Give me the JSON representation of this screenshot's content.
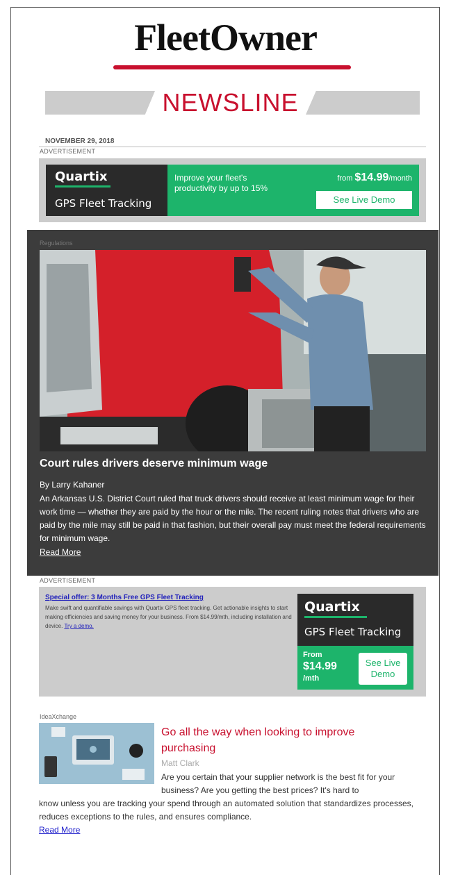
{
  "header": {
    "logo": "FleetOwner",
    "newsline": "NEWSLINE",
    "date": "NOVEMBER 29, 2018"
  },
  "ad1": {
    "label": "ADVERTISEMENT",
    "brand": "Quartix",
    "product": "GPS Fleet Tracking",
    "tagline": "Improve your fleet's productivity by up to 15%",
    "price_prefix": "from",
    "price": "$14.99",
    "price_suffix": "/month",
    "cta": "See Live Demo"
  },
  "feature": {
    "category": "Regulations",
    "title": "Court rules drivers deserve minimum wage",
    "byline": "By Larry Kahaner",
    "body": "An Arkansas U.S. District Court ruled that truck drivers should receive at least minimum wage for their work time — whether they are paid by the hour or the mile. The recent ruling notes that drivers who are paid by the mile may still be paid in that fashion, but their overall pay must meet the federal requirements for minimum wage.",
    "read_more": "Read More"
  },
  "ad2": {
    "label": "ADVERTISEMENT",
    "title": "Special offer: 3 Months Free GPS Fleet Tracking",
    "body": "Make swift and quantifiable savings with Quartix GPS fleet tracking. Get actionable insights to start making efficiencies and saving money for your business. From $14.99/mth, including installation and device.",
    "link": "Try a demo.",
    "brand": "Quartix",
    "product": "GPS Fleet Tracking",
    "from": "From",
    "price": "$14.99",
    "per": "/mth",
    "cta": "See Live Demo"
  },
  "story2": {
    "category": "IdeaXchange",
    "title": "Go all the way when looking to improve purchasing",
    "author": "Matt Clark",
    "body_part1": "Are you certain that your supplier network is the best fit for your business? Are you getting the best prices? It's hard to",
    "body_part2": "know unless you are tracking your spend through an automated solution that standardizes processes, reduces exceptions to the rules, and ensures compliance.",
    "read_more": "Read More"
  },
  "colors": {
    "brand_red": "#c8102e",
    "quartix_green": "#1db46b",
    "feature_bg": "#3c3c3c",
    "link_blue": "#2222cc"
  }
}
